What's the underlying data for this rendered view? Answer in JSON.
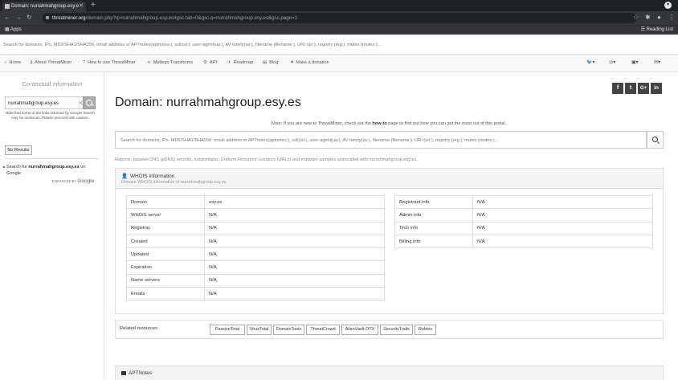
{
  "browser": {
    "tab_title": "Domain: nurrahmahgroup.esy.e",
    "url_host": "threatminer.org",
    "url_rest": "/domain.php?q=nurrahmahgroup.esy.es#gsc.tab=0&gsc.q=nurrahmahgroup.esy.es&gsc.page=1",
    "bookmarks_apps": "Apps",
    "reading_list": "Reading List"
  },
  "top_search": {
    "placeholder": "Search for domains, IPs, MD5/SHA1/SHA256, email address or APTnotes(aptnotes:), ssl(ssl:), user-agent(ua:), AV family(av:), filename (filename:), URI (uri:), registry (reg:), mutex (mutex:)..."
  },
  "navbar": {
    "home": "Home",
    "about": "About ThreatMiner",
    "howto": "How to use ThreatMiner",
    "maltego": "Maltego Transforms",
    "api": "API",
    "roadmap": "Roadmap",
    "blog": "Blog",
    "donation": "Make a donation"
  },
  "sidebar": {
    "title": "Contextual information",
    "search_value": "nurrahmahgroup.esy.es",
    "note": "Note that some of the links returned by Google Search may be malicious. Please proceed with caution.",
    "no_results": "No Results",
    "google_prefix": "Search for ",
    "google_term": "nurrahmahgroup.esy.es",
    "google_suffix": " on Google",
    "enhanced_by": "ENHANCED BY",
    "google": "Google"
  },
  "main": {
    "title": "Domain: nurrahmahgroup.esy.es",
    "note_prefix": "Note: If you are new to ThreatMiner, check out the ",
    "note_link": "how-to",
    "note_suffix": " page to find out how you can get the most out of this portal.",
    "search_placeholder": "Search for domains, IPs, MD5/SHA1/SHA256, email address or APTnotes(aptnotes:), ssl(ssl:), user-agent(ua:), AV family(av:), filename (filename:), URI (uri:), registry (reg:), mutex (mutex:)...",
    "summary": "Reports, passive DNS (pDNS) records, subdomains, Uniform Resource Locators (URLs) and malware samples associated with nurrahmahgroup.esy.es.",
    "social": [
      "f",
      "t",
      "G+",
      "in"
    ]
  },
  "whois": {
    "title": "WHOIS Information",
    "subtitle": "Domain WHOIS information of nurrahmahgroup.esy.es.",
    "left": [
      {
        "label": "Domain",
        "value": "esy.es"
      },
      {
        "label": "WHOIS server",
        "value": "N/A"
      },
      {
        "label": "Registrar",
        "value": "N/A"
      },
      {
        "label": "Created",
        "value": "N/A"
      },
      {
        "label": "Updated",
        "value": "N/A"
      },
      {
        "label": "Expiration",
        "value": "N/A"
      },
      {
        "label": "Name servers",
        "value": "N/A"
      },
      {
        "label": "Emails",
        "value": "N/A"
      }
    ],
    "right": [
      {
        "label": "Registrant info",
        "value": "N/A"
      },
      {
        "label": "Admin info",
        "value": "N/A"
      },
      {
        "label": "Tech info",
        "value": "N/A"
      },
      {
        "label": "Billing info",
        "value": "N/A"
      }
    ]
  },
  "related": {
    "label": "Related resources",
    "buttons": [
      "PassiveTotal",
      "VirusTotal",
      "DomainTools",
      "ThreatCrowd",
      "AlienVault OTX",
      "SecurityTrails",
      "Robtex"
    ]
  },
  "aptnotes": {
    "title": "APTNotes"
  }
}
